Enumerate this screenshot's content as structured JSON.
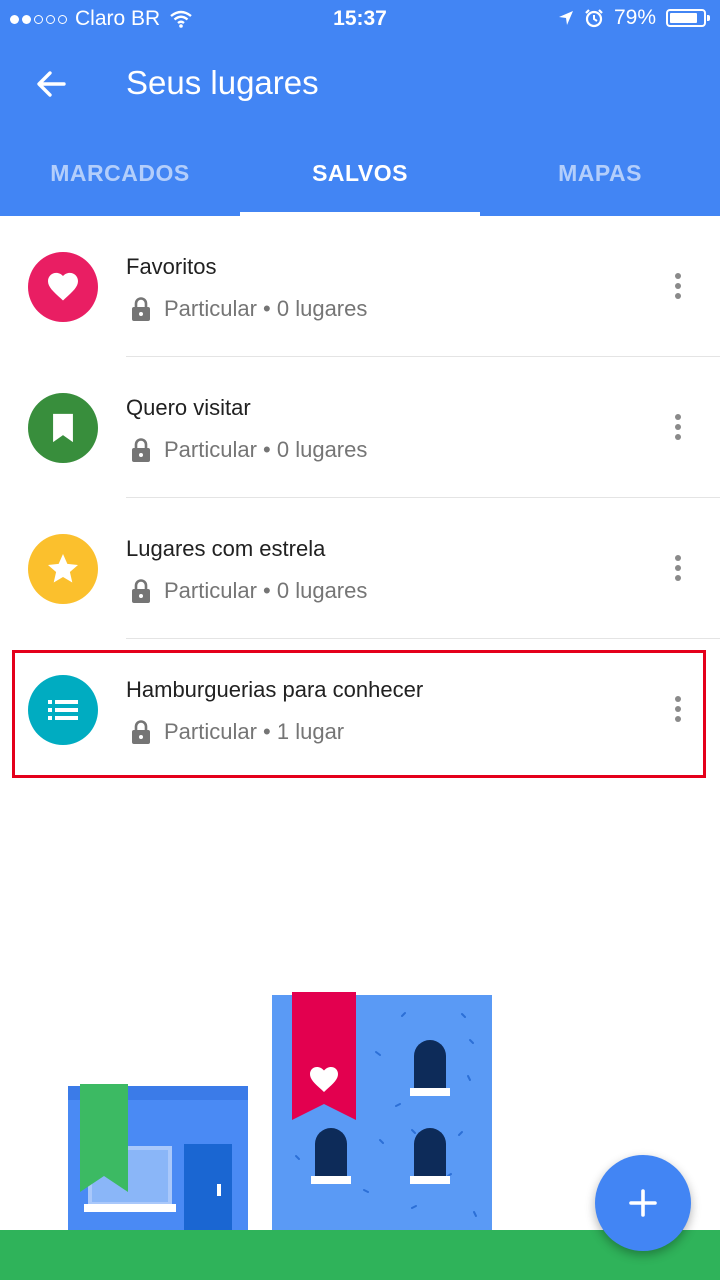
{
  "status_bar": {
    "carrier": "Claro BR",
    "time": "15:37",
    "battery": "79%"
  },
  "header": {
    "title": "Seus lugares"
  },
  "tabs": [
    {
      "label": "MARCADOS",
      "active": false
    },
    {
      "label": "SALVOS",
      "active": true
    },
    {
      "label": "MAPAS",
      "active": false
    }
  ],
  "lists": [
    {
      "title": "Favoritos",
      "privacy": "Particular",
      "count": "0 lugares",
      "icon": "heart-icon",
      "color": "#e91e63"
    },
    {
      "title": "Quero visitar",
      "privacy": "Particular",
      "count": "0 lugares",
      "icon": "bookmark-icon",
      "color": "#388e3c"
    },
    {
      "title": "Lugares com estrela",
      "privacy": "Particular",
      "count": "0 lugares",
      "icon": "star-icon",
      "color": "#fbc02d"
    },
    {
      "title": "Hamburguerias para conhecer",
      "privacy": "Particular",
      "count": "1 lugar",
      "icon": "list-icon",
      "color": "#00acc1"
    }
  ],
  "colors": {
    "primary": "#4285f4",
    "highlight": "#e4001b"
  },
  "fab": {
    "icon": "plus-icon"
  }
}
